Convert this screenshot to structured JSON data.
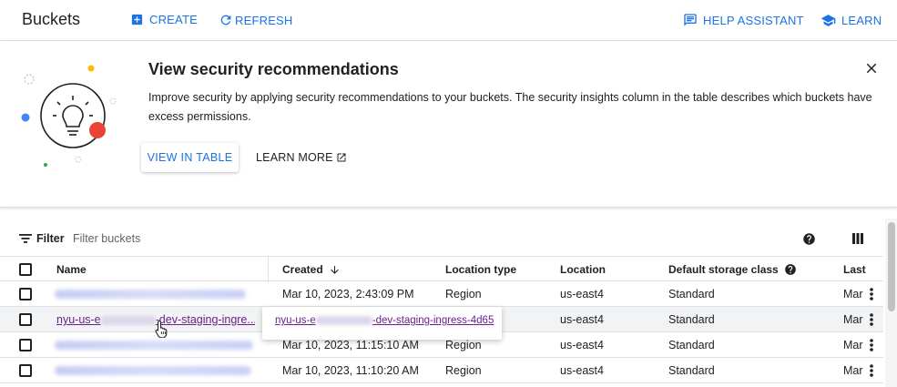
{
  "header": {
    "title": "Buckets",
    "create_label": "CREATE",
    "refresh_label": "REFRESH",
    "help_label": "HELP ASSISTANT",
    "learn_label": "LEARN"
  },
  "banner": {
    "title": "View security recommendations",
    "description": "Improve security by applying security recommendations to your buckets. The security insights column in the table describes which buckets have excess permissions.",
    "view_button": "VIEW IN TABLE",
    "learn_more": "LEARN MORE"
  },
  "filter": {
    "label": "Filter",
    "placeholder": "Filter buckets"
  },
  "table": {
    "columns": [
      "Name",
      "Created",
      "Location type",
      "Location",
      "Default storage class",
      "Last"
    ],
    "rows": [
      {
        "name": "",
        "created": "Mar 10, 2023, 2:43:09 PM",
        "location_type": "Region",
        "location": "us-east4",
        "storage_class": "Standard",
        "last": "Mar"
      },
      {
        "name_prefix": "nyu-us-e",
        "name_suffix": "-dev-staging-ingre...",
        "created": "",
        "location_type": "",
        "location": "us-east4",
        "storage_class": "Standard",
        "last": "Mar"
      },
      {
        "name": "",
        "created": "Mar 10, 2023, 11:15:10 AM",
        "location_type": "Region",
        "location": "us-east4",
        "storage_class": "Standard",
        "last": "Mar"
      },
      {
        "name": "",
        "created": "Mar 10, 2023, 11:10:20 AM",
        "location_type": "Region",
        "location": "us-east4",
        "storage_class": "Standard",
        "last": "Mar"
      }
    ],
    "tooltip_prefix": "nyu-us-e",
    "tooltip_suffix": "-dev-staging-ingress-4d65"
  },
  "colors": {
    "accent": "#1a73e8",
    "visited_link": "#6b1f8a",
    "text": "#202124"
  },
  "icons": [
    "add-box-icon",
    "refresh-icon",
    "chat-icon",
    "school-icon",
    "close-icon",
    "open-in-new-icon",
    "filter-icon",
    "help-icon",
    "columns-icon",
    "arrow-down-icon",
    "more-vert-icon",
    "hand-cursor-icon"
  ]
}
